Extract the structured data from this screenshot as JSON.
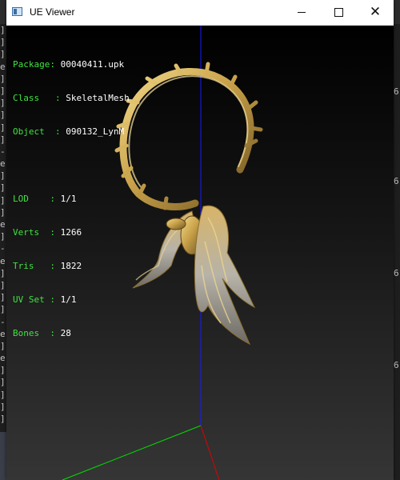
{
  "window": {
    "title": "UE Viewer"
  },
  "info": {
    "package_label": "Package",
    "package_value": "00040411.upk",
    "class_label": "Class",
    "class_value": "SkeletalMesh",
    "object_label": "Object",
    "object_value": "090132_LynM",
    "lod_label": "LOD",
    "lod_value": "1/1",
    "verts_label": "Verts",
    "verts_value": "1266",
    "tris_label": "Tris",
    "tris_value": "1822",
    "uvset_label": "UV Set",
    "uvset_value": "1/1",
    "bones_label": "Bones",
    "bones_value": "28"
  },
  "background": {
    "left_chars": [
      "]",
      "]",
      "]",
      "e",
      "]",
      "]",
      "]",
      "]",
      "]",
      "]",
      "-",
      "e",
      "]",
      "]",
      "]",
      "]",
      "e",
      "]",
      "-",
      "e",
      "]",
      "]",
      "]",
      "]",
      "-",
      "e",
      "]",
      "e",
      "]",
      "]",
      "]",
      "]",
      "]"
    ],
    "right_chars": [
      "6",
      "6",
      "6",
      "6"
    ]
  },
  "colors": {
    "axis_x": "#ff0000",
    "axis_y": "#00ff00",
    "axis_z": "#0000ff",
    "info_label": "#3fe33f",
    "info_value": "#ffffff",
    "mesh_gold": "#c9a24a"
  }
}
